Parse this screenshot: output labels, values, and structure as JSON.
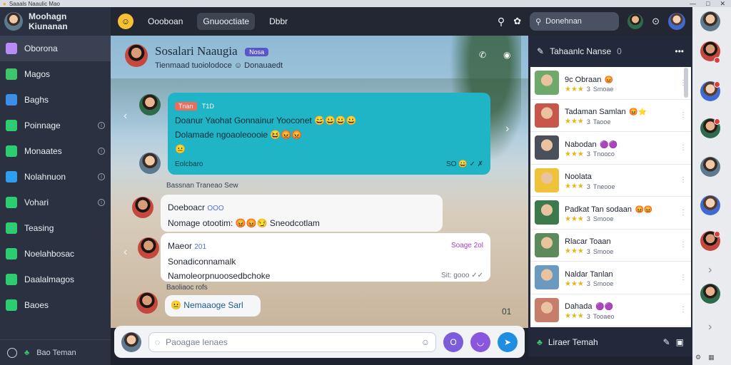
{
  "titlebar": {
    "app_title": "Saaals Naaulic Mao",
    "min": "—",
    "max": "□",
    "close": "✕"
  },
  "profile": {
    "name": "Moohagn Kiunanan"
  },
  "sidebar": {
    "items": [
      {
        "label": "Oborona",
        "icon": "chat-icon",
        "color": "#b78cf5"
      },
      {
        "label": "Magos",
        "icon": "clover-icon",
        "color": "#3ec56b"
      },
      {
        "label": "Baghs",
        "icon": "puzzle-icon",
        "color": "#3b8fe8"
      },
      {
        "label": "Poinnage",
        "icon": "triangle-icon",
        "color": "#2ecc71"
      },
      {
        "label": "Monaates",
        "icon": "box-icon",
        "color": "#2ecc71"
      },
      {
        "label": "Nolahnuon",
        "icon": "list-icon",
        "color": "#2f9df0"
      },
      {
        "label": "Vohari",
        "icon": "coin-icon",
        "color": "#2ecc71"
      },
      {
        "label": "Teasing",
        "icon": "square-icon",
        "color": "#2ecc71"
      },
      {
        "label": "Noelahbosac",
        "icon": "square-icon",
        "color": "#2ecc71"
      },
      {
        "label": "Daalalmagos",
        "icon": "shield-icon",
        "color": "#2ecc71"
      },
      {
        "label": "Baoes",
        "icon": "home-icon",
        "color": "#2ecc71"
      }
    ],
    "footer_label": "Bao Teman"
  },
  "topbar": {
    "tabs": [
      "Oooboan",
      "Gnuooctiate",
      "Dbbr"
    ],
    "search_label": "Donehnan"
  },
  "chat": {
    "title": "Sosalari Naaugia",
    "title_chip": "Nosa",
    "subtitle": "Tienmaad tuoiolodoce ☺ Donauaedt",
    "m1": {
      "tag": "Tnan",
      "tag_num": "T1D",
      "line1": "Doanur Yaohat Gonnainur Yooconet 😅😀😀😀",
      "line2": "Dolamade ngoaoleoooie 😆😡😡",
      "line3": "😐",
      "footer": "Eolcbaro",
      "footer_right": "SO 😀 ✓ ✗"
    },
    "sys1": "Bassnan Traneao Sew",
    "m2": {
      "line1": "Doeboacr",
      "line1_tag": "OOO",
      "line2": "Nomage otootim: 😡😡😏 Sneodcotlam"
    },
    "m3": {
      "name": "Maeor",
      "name_tag": "201",
      "line1": "Sonadiconnamalk",
      "line2": "Namoleorpnuoosedbchoke",
      "right1": "Soage 2ol",
      "right2": "Sit: gooo ✓✓"
    },
    "sys2": "Baoliaoc rofs",
    "m4": {
      "text": "Nemaaoge Sarl"
    },
    "read_mark": "01"
  },
  "composer": {
    "placeholder": "Paoagae lenaes"
  },
  "panel": {
    "title": "Tahaanlc Nanse",
    "count": "0",
    "contacts": [
      {
        "name": "9c Obraan",
        "emoji": "😡",
        "rating": "3",
        "label": "Smoae",
        "color": "#6ea86a"
      },
      {
        "name": "Tadaman Samlan",
        "emoji": "😡⭐",
        "rating": "3",
        "label": "Taooe",
        "color": "#c9564a"
      },
      {
        "name": "Nabodan",
        "emoji": "🟣🟣",
        "rating": "3",
        "label": "Tnooco",
        "color": "#4a4f5c"
      },
      {
        "name": "Noolata",
        "emoji": "",
        "rating": "3",
        "label": "Tneooe",
        "color": "#f0c23a"
      },
      {
        "name": "Padkat Tan sodaan",
        "emoji": "😡😡",
        "rating": "3",
        "label": "Smooe",
        "color": "#3b7a4a"
      },
      {
        "name": "Rlacar Toaan",
        "emoji": "",
        "rating": "3",
        "label": "Smooe",
        "color": "#5d8a5a"
      },
      {
        "name": "Naldar Tanlan",
        "emoji": "",
        "rating": "3",
        "label": "Smooe",
        "color": "#6b9ac0"
      },
      {
        "name": "Dahada",
        "emoji": "🟣🟣",
        "rating": "3",
        "label": "Tooaeo",
        "color": "#c77d6a"
      }
    ],
    "footer_label": "Liraer Temah"
  }
}
